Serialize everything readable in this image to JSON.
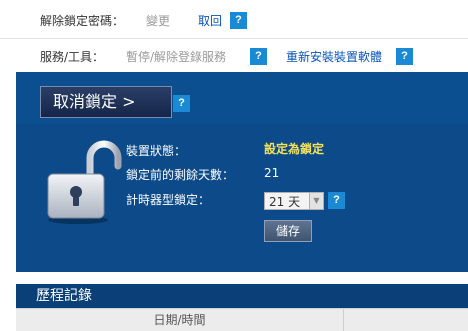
{
  "settings": {
    "unlock_password": {
      "label": "解除鎖定密碼：",
      "change": "變更",
      "retrieve": "取回"
    },
    "service_tools": {
      "label": "服務/工具：",
      "pause": "暫停/解除登錄服務",
      "reinstall": "重新安裝裝置軟體"
    }
  },
  "lock_panel": {
    "unlock_button": "取消鎖定 >",
    "status_label": "裝置狀態：",
    "status_value": "設定為鎖定",
    "days_left_label": "鎖定前的剩餘天數：",
    "days_left_value": "21",
    "timer_label": "計時器型鎖定：",
    "timer_selected": "21 天",
    "save_button": "儲存"
  },
  "help_glyph": "?",
  "history": {
    "title": "歷程記錄",
    "columns": [
      "日期/時間"
    ]
  },
  "colors": {
    "panel_bg": "#0c4a8a",
    "help_button": "#1a8ad4",
    "status_highlight": "#f4e15a",
    "link": "#0a55b8"
  },
  "icons": [
    "help-icon",
    "unlocked-padlock-icon",
    "chevron-down-icon"
  ]
}
